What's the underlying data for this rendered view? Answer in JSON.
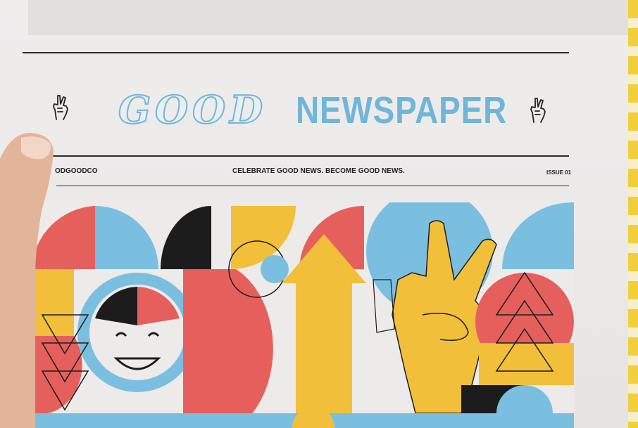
{
  "masthead": {
    "title_part1": "GOOD",
    "title_part2": "NEWSPAPER",
    "tagline": "CELEBRATE GOOD NEWS. BECOME GOOD NEWS.",
    "left_label": "ODGOODCO",
    "issue": "ISSUE 01"
  },
  "colors": {
    "paper": "#ecebea",
    "blue": "#7bbfe0",
    "red": "#e5605c",
    "yellow": "#f2bf3a",
    "black": "#1c1c1c",
    "title_blue": "#6fb6d9"
  },
  "icons": [
    "peace-hand-icon-left",
    "peace-hand-icon-right"
  ]
}
